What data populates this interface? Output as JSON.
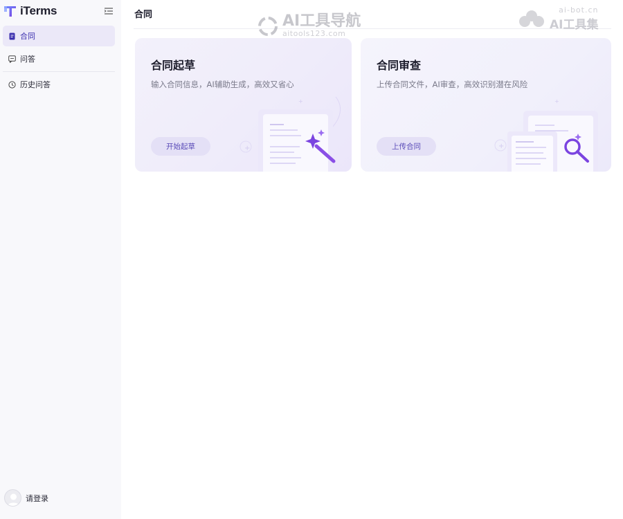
{
  "app": {
    "name": "iTerms"
  },
  "sidebar": {
    "items": [
      {
        "label": "合同",
        "icon": "document-icon",
        "active": true
      },
      {
        "label": "问答",
        "icon": "chat-icon",
        "active": false
      },
      {
        "label": "历史问答",
        "icon": "clock-icon",
        "active": false
      }
    ],
    "login_label": "请登录"
  },
  "main": {
    "title": "合同",
    "cards": [
      {
        "title": "合同起草",
        "description": "输入合同信息，AI辅助生成，高效又省心",
        "button": "开始起草"
      },
      {
        "title": "合同审查",
        "description": "上传合同文件，AI审查，高效识别潜在风险",
        "button": "上传合同"
      }
    ]
  },
  "watermarks": {
    "left_main": "AI工具导航",
    "left_sub": "aitools123.com",
    "right_sub": "ai-bot.cn",
    "right_main": "AI工具集"
  },
  "colors": {
    "accent": "#3f33b0",
    "active_bg": "#ebe8f8",
    "button_bg": "#e4e0f6",
    "button_text": "#5a4bb8",
    "sidebar_bg": "#f8f8fb"
  }
}
